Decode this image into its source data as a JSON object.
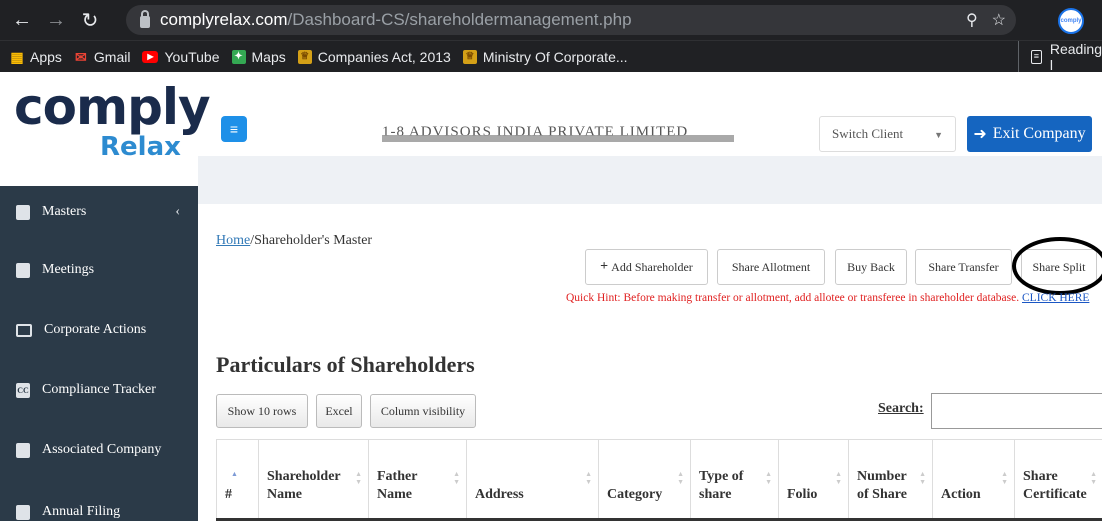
{
  "browser": {
    "url_domain": "complyrelax.com",
    "url_path": "/Dashboard-CS/shareholdermanagement.php",
    "bookmarks": [
      {
        "label": "Apps",
        "icon": "apps-grid-icon"
      },
      {
        "label": "Gmail",
        "icon": "gmail-icon"
      },
      {
        "label": "YouTube",
        "icon": "youtube-icon"
      },
      {
        "label": "Maps",
        "icon": "maps-icon"
      },
      {
        "label": "Companies Act, 2013",
        "icon": "national-emblem-icon"
      },
      {
        "label": "Ministry Of Corporate...",
        "icon": "national-emblem-icon"
      }
    ],
    "reading_list": "Reading l"
  },
  "app": {
    "logo_top": "comply",
    "logo_bottom": "Relax",
    "company_name": "1-8 ADVISORS INDIA PRIVATE LIMITED",
    "switch_client": "Switch Client",
    "exit_company": "Exit Company"
  },
  "sidebar": {
    "items": [
      {
        "label": "Masters",
        "icon": "book-icon"
      },
      {
        "label": "Meetings",
        "icon": "briefcase-icon"
      },
      {
        "label": "Corporate Actions",
        "icon": "monitor-icon"
      },
      {
        "label": "Compliance Tracker",
        "icon": "cc-icon"
      },
      {
        "label": "Associated Company",
        "icon": "building-icon"
      },
      {
        "label": "Annual Filing",
        "icon": "file-icon"
      }
    ]
  },
  "page": {
    "breadcrumb_home": "Home",
    "breadcrumb_current": "/Shareholder's Master",
    "actions": {
      "add": "Add Shareholder",
      "allot": "Share Allotment",
      "buyback": "Buy Back",
      "transfer": "Share Transfer",
      "split": "Share Split"
    },
    "hint": "Quick Hint: Before making transfer or allotment, add allotee or transferee in shareholder database.",
    "hint_link": "CLICK HERE",
    "title": "Particulars of Shareholders",
    "tools": {
      "rows": "Show 10 rows",
      "excel": "Excel",
      "columns": "Column visibility"
    },
    "search_label": "Search:",
    "search_value": ""
  },
  "table": {
    "columns": [
      [
        "#"
      ],
      [
        "Shareholder",
        "Name"
      ],
      [
        "Father",
        "Name"
      ],
      [
        "Address"
      ],
      [
        "Category"
      ],
      [
        "Type of",
        "share"
      ],
      [
        "Folio"
      ],
      [
        "Number",
        "of Share"
      ],
      [
        "Action"
      ],
      [
        "Share",
        "Certificate"
      ]
    ]
  },
  "colors": {
    "sidebar": "#2b3a48",
    "primary": "#1565c0",
    "hint": "#e02020"
  }
}
